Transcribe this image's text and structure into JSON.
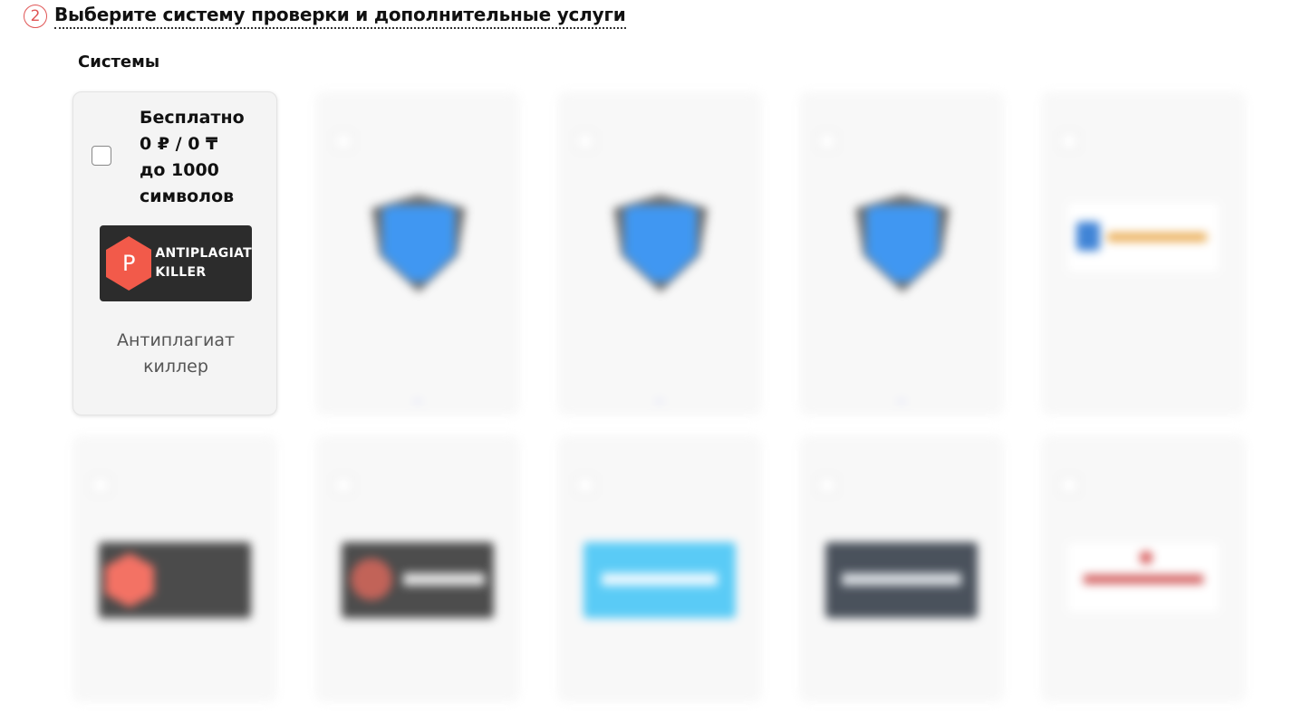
{
  "step": {
    "number": "2",
    "title": "Выберите систему проверки и дополнительные услуги"
  },
  "section": {
    "label": "Системы"
  },
  "cards": [
    {
      "price_line1": "Бесплатно",
      "price_line2": "0 ₽ / 0 ₸",
      "price_line3": "до 1000",
      "price_line4": "символов",
      "logo": "antiplagiat-killer-logo",
      "logo_text1": "ANTIPLAGIAT",
      "logo_text2": "KILLER",
      "logo_letter": "P",
      "name_line1": "Антиплагиат",
      "name_line2": "киллер",
      "checked": false
    }
  ],
  "colors": {
    "accent": "#e05555",
    "link": "#5a6cf0",
    "shield": "#1f86f0"
  }
}
